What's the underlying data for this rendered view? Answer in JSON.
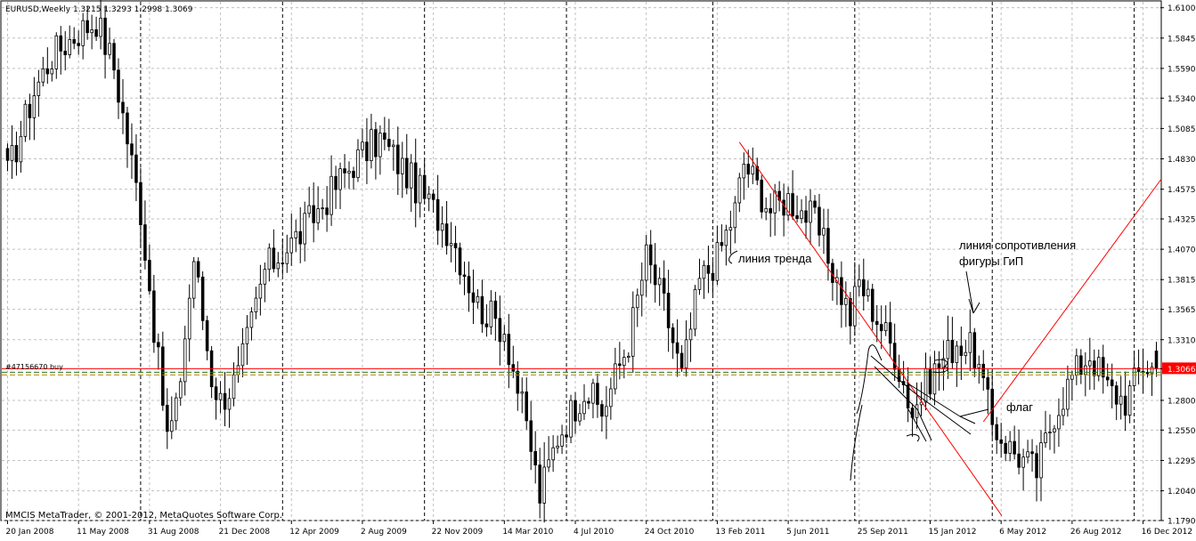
{
  "header": {
    "symbol_line": "EURUSD,Weekly  1.3215 1.3293 1.2998 1.3069"
  },
  "footer": {
    "copyright": "MMCIS MetaTrader, © 2001-2012, MetaQuotes Software Corp."
  },
  "colors": {
    "background": "#ffffff",
    "candle": "#000000",
    "grid": "#c0c0c0",
    "trendline": "#ff0000",
    "order_line": "#ff0000",
    "bid_badge": "#ff0000"
  },
  "chart_data": {
    "type": "candlestick",
    "timeframe": "Weekly",
    "symbol": "EURUSD",
    "last_bar": {
      "open": 1.3215,
      "high": 1.3293,
      "low": 1.2998,
      "close": 1.3069
    },
    "current_price_label": "1.3066",
    "current_price": 1.3066,
    "ylim": [
      1.179,
      1.615
    ],
    "y_ticks": [
      "1.6100",
      "1.5845",
      "1.5590",
      "1.5340",
      "1.5085",
      "1.4830",
      "1.4575",
      "1.4325",
      "1.4070",
      "1.3815",
      "1.3565",
      "1.3310",
      "1.3066",
      "1.2800",
      "1.2550",
      "1.2295",
      "1.2040",
      "1.1790"
    ],
    "x_ticks": [
      "20 Jan 2008",
      "11 May 2008",
      "31 Aug 2008",
      "21 Dec 2008",
      "12 Apr 2009",
      "2 Aug 2009",
      "22 Nov 2009",
      "14 Mar 2010",
      "4 Jul 2010",
      "24 Oct 2010",
      "13 Feb 2011",
      "5 Jun 2011",
      "25 Sep 2011",
      "15 Jan 2012",
      "6 May 2012",
      "26 Aug 2012",
      "16 Dec 2012"
    ],
    "grid": true,
    "weeks": 260,
    "order": {
      "label": "#47156670 buy",
      "price": 1.3066
    },
    "separators_at_week": [
      30,
      62,
      94,
      126,
      159,
      191,
      222,
      254
    ],
    "price_path": [
      [
        0,
        1.47
      ],
      [
        6,
        1.54
      ],
      [
        10,
        1.57
      ],
      [
        16,
        1.59
      ],
      [
        20,
        1.6
      ],
      [
        24,
        1.56
      ],
      [
        30,
        1.44
      ],
      [
        34,
        1.31
      ],
      [
        36,
        1.25
      ],
      [
        38,
        1.27
      ],
      [
        42,
        1.4
      ],
      [
        46,
        1.3
      ],
      [
        48,
        1.28
      ],
      [
        52,
        1.3
      ],
      [
        58,
        1.39
      ],
      [
        66,
        1.42
      ],
      [
        72,
        1.45
      ],
      [
        78,
        1.48
      ],
      [
        84,
        1.5
      ],
      [
        90,
        1.47
      ],
      [
        96,
        1.44
      ],
      [
        100,
        1.42
      ],
      [
        106,
        1.36
      ],
      [
        112,
        1.34
      ],
      [
        118,
        1.24
      ],
      [
        120,
        1.2
      ],
      [
        124,
        1.25
      ],
      [
        130,
        1.29
      ],
      [
        134,
        1.27
      ],
      [
        140,
        1.33
      ],
      [
        144,
        1.4
      ],
      [
        148,
        1.36
      ],
      [
        152,
        1.3
      ],
      [
        156,
        1.38
      ],
      [
        160,
        1.4
      ],
      [
        164,
        1.44
      ],
      [
        166,
        1.48
      ],
      [
        172,
        1.44
      ],
      [
        176,
        1.45
      ],
      [
        182,
        1.43
      ],
      [
        186,
        1.39
      ],
      [
        190,
        1.35
      ],
      [
        192,
        1.38
      ],
      [
        196,
        1.35
      ],
      [
        200,
        1.32
      ],
      [
        204,
        1.27
      ],
      [
        208,
        1.3
      ],
      [
        214,
        1.33
      ],
      [
        218,
        1.32
      ],
      [
        222,
        1.26
      ],
      [
        226,
        1.24
      ],
      [
        232,
        1.22
      ],
      [
        236,
        1.27
      ],
      [
        240,
        1.3
      ],
      [
        244,
        1.32
      ],
      [
        248,
        1.29
      ],
      [
        252,
        1.28
      ],
      [
        256,
        1.31
      ],
      [
        259,
        1.3066
      ]
    ],
    "annotations": [
      {
        "text": "линия тренда"
      },
      {
        "text": "линия сопротивления"
      },
      {
        "text": "фигуры ГиП"
      },
      {
        "text": "флаг"
      }
    ]
  }
}
